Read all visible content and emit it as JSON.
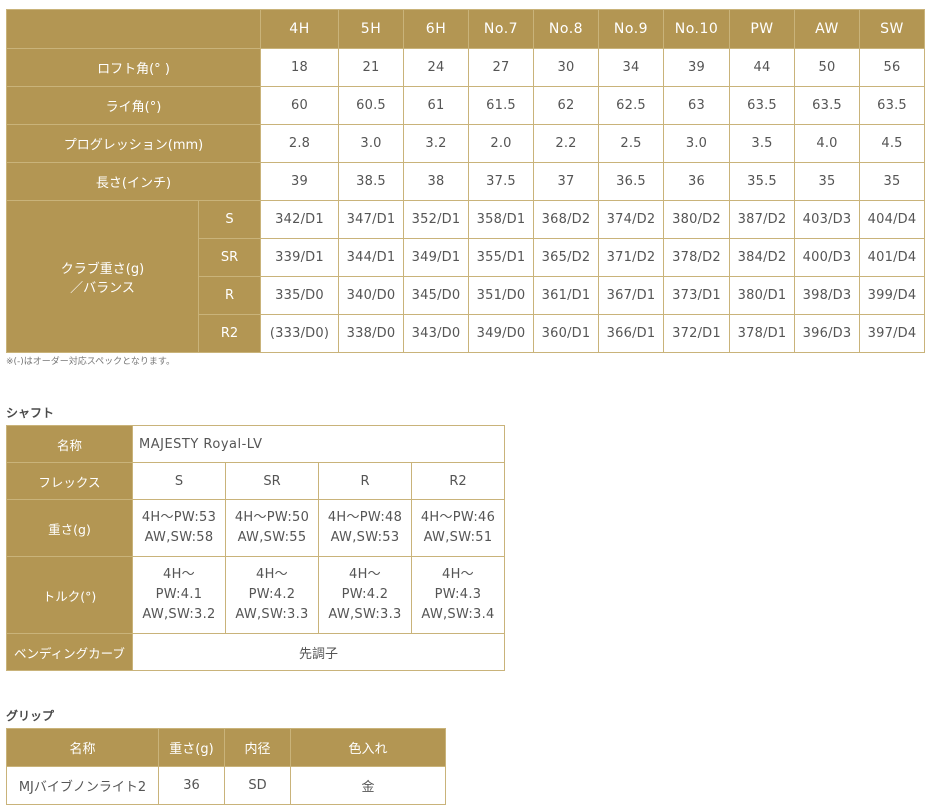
{
  "spec": {
    "models": [
      "4H",
      "5H",
      "6H",
      "No.7",
      "No.8",
      "No.9",
      "No.10",
      "PW",
      "AW",
      "SW"
    ],
    "rows": [
      {
        "label": "ロフト角(° )",
        "values": [
          "18",
          "21",
          "24",
          "27",
          "30",
          "34",
          "39",
          "44",
          "50",
          "56"
        ]
      },
      {
        "label": "ライ角(°)",
        "values": [
          "60",
          "60.5",
          "61",
          "61.5",
          "62",
          "62.5",
          "63",
          "63.5",
          "63.5",
          "63.5"
        ]
      },
      {
        "label": "プログレッション(mm)",
        "values": [
          "2.8",
          "3.0",
          "3.2",
          "2.0",
          "2.2",
          "2.5",
          "3.0",
          "3.5",
          "4.0",
          "4.5"
        ]
      },
      {
        "label": "長さ(インチ)",
        "values": [
          "39",
          "38.5",
          "38",
          "37.5",
          "37",
          "36.5",
          "36",
          "35.5",
          "35",
          "35"
        ]
      }
    ],
    "weight_label_line1": "クラブ重さ(g)",
    "weight_label_line2": "／バランス",
    "weight_rows": [
      {
        "flex": "S",
        "values": [
          "342/D1",
          "347/D1",
          "352/D1",
          "358/D1",
          "368/D2",
          "374/D2",
          "380/D2",
          "387/D2",
          "403/D3",
          "404/D4"
        ]
      },
      {
        "flex": "SR",
        "values": [
          "339/D1",
          "344/D1",
          "349/D1",
          "355/D1",
          "365/D2",
          "371/D2",
          "378/D2",
          "384/D2",
          "400/D3",
          "401/D4"
        ]
      },
      {
        "flex": "R",
        "values": [
          "335/D0",
          "340/D0",
          "345/D0",
          "351/D0",
          "361/D1",
          "367/D1",
          "373/D1",
          "380/D1",
          "398/D3",
          "399/D4"
        ]
      },
      {
        "flex": "R2",
        "values": [
          "(333/D0)",
          "338/D0",
          "343/D0",
          "349/D0",
          "360/D1",
          "366/D1",
          "372/D1",
          "378/D1",
          "396/D3",
          "397/D4"
        ]
      }
    ],
    "note": "※(-)はオーダー対応スペックとなります。"
  },
  "shaft": {
    "title": "シャフト",
    "name_label": "名称",
    "name_value": "MAJESTY Royal-LV",
    "flex_label": "フレックス",
    "flexes": [
      "S",
      "SR",
      "R",
      "R2"
    ],
    "weight_label": "重さ(g)",
    "weights": [
      {
        "line1": "4H～PW:53",
        "line2": "AW,SW:58"
      },
      {
        "line1": "4H～PW:50",
        "line2": "AW,SW:55"
      },
      {
        "line1": "4H～PW:48",
        "line2": "AW,SW:53"
      },
      {
        "line1": "4H～PW:46",
        "line2": "AW,SW:51"
      }
    ],
    "torque_label": "トルク(°)",
    "torques": [
      {
        "line1": "4H～",
        "line2": "PW:4.1",
        "line3": "AW,SW:3.2"
      },
      {
        "line1": "4H～",
        "line2": "PW:4.2",
        "line3": "AW,SW:3.3"
      },
      {
        "line1": "4H～",
        "line2": "PW:4.2",
        "line3": "AW,SW:3.3"
      },
      {
        "line1": "4H～",
        "line2": "PW:4.3",
        "line3": "AW,SW:3.4"
      }
    ],
    "bend_label": "ベンディングカーブ",
    "bend_value": "先調子"
  },
  "grip": {
    "title": "グリップ",
    "headers": [
      "名称",
      "重さ(g)",
      "内径",
      "色入れ"
    ],
    "values": [
      "MJバイブノンライト2",
      "36",
      "SD",
      "金"
    ]
  },
  "colors": {
    "header_bg": "#b39653",
    "border": "#c9b37a",
    "text": "#555555"
  }
}
